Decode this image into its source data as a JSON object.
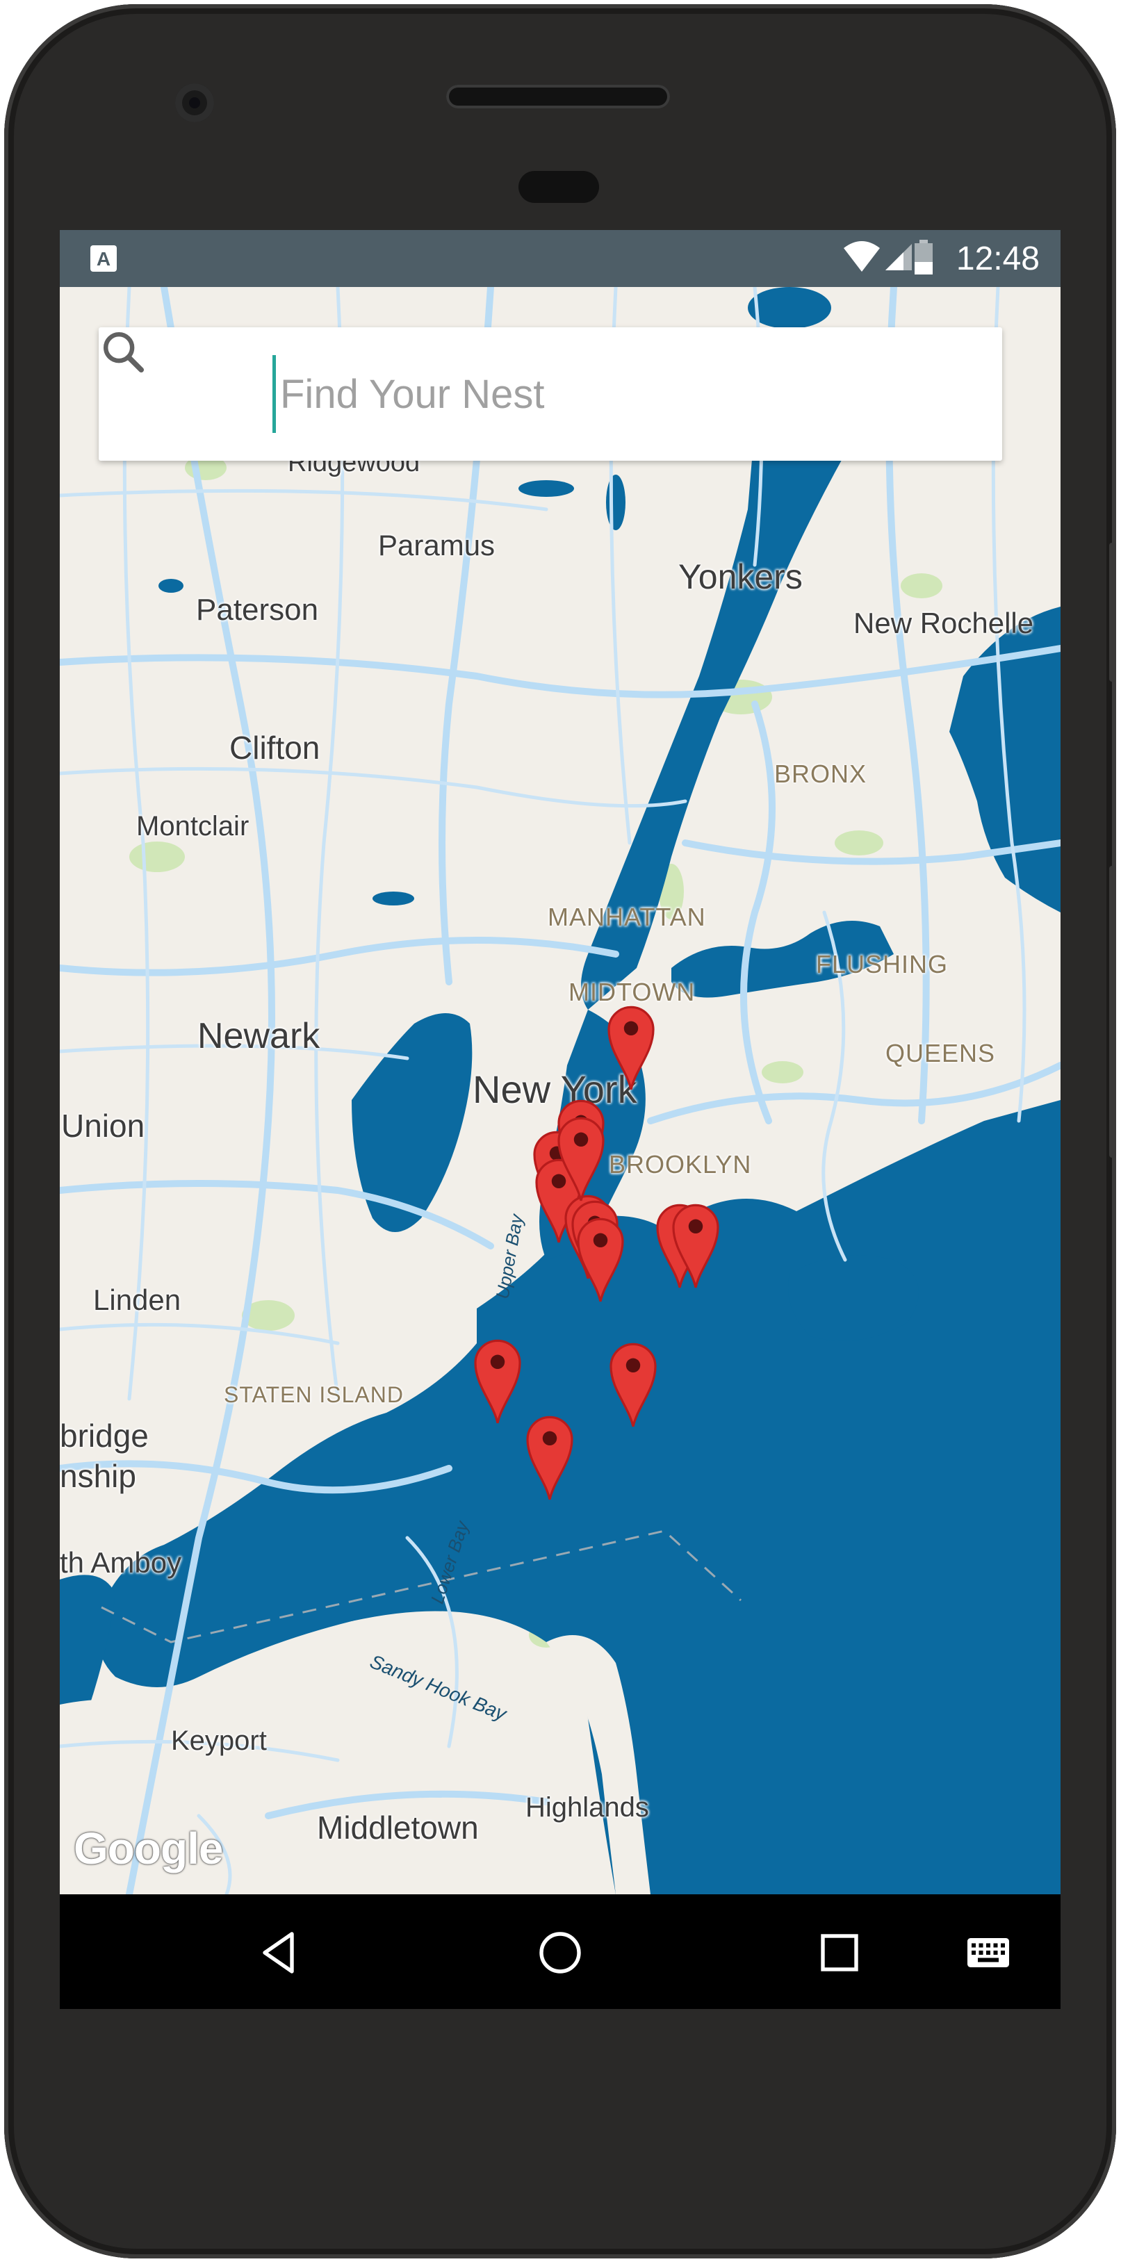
{
  "status_bar": {
    "time": "12:48",
    "notification_icon": "a-icon",
    "icons": [
      "wifi-icon",
      "signal-icon",
      "battery-icon"
    ]
  },
  "search": {
    "placeholder": "Find Your Nest",
    "value": "",
    "icon": "search-icon"
  },
  "map": {
    "attribution": "Google",
    "labels": {
      "ridgewood": "Ridgewood",
      "paramus": "Paramus",
      "yonkers": "Yonkers",
      "paterson": "Paterson",
      "new_rochelle": "New Rochelle",
      "clifton": "Clifton",
      "bronx": "BRONX",
      "montclair": "Montclair",
      "manhattan": "MANHATTAN",
      "flushing": "FLUSHING",
      "midtown": "MIDTOWN",
      "newark": "Newark",
      "queens": "QUEENS",
      "new_york": "New York",
      "union": "Union",
      "brooklyn": "BROOKLYN",
      "upper_bay": "Upper Bay",
      "linden": "Linden",
      "staten_island": "STATEN ISLAND",
      "bridge": "bridge",
      "nship": "nship",
      "th_amboy": "th Amboy",
      "lower_bay": "Lower Bay",
      "sandy_hook_bay": "Sandy Hook Bay",
      "keyport": "Keyport",
      "highlands": "Highlands",
      "middletown": "Middletown"
    },
    "marker_count": 13,
    "marker_color": "#e53935",
    "water_color": "#0b6aa0",
    "land_color": "#f2efe9",
    "road_color": "#b9dcf5"
  },
  "nav_bar": {
    "buttons": [
      "back-icon",
      "home-icon",
      "recents-icon",
      "keyboard-icon"
    ]
  }
}
